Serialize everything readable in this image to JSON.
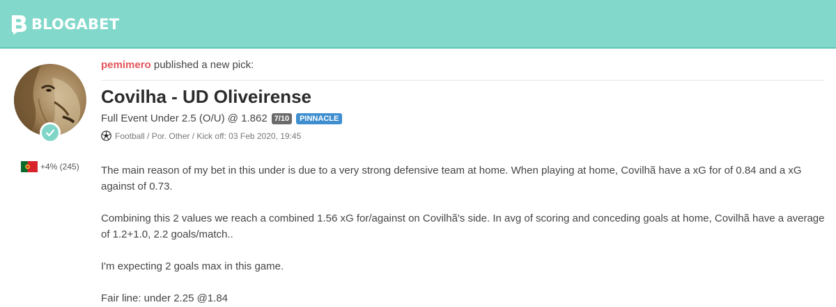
{
  "brand": {
    "name": "BLOGABET",
    "accent": "#82d9cb"
  },
  "post": {
    "username": "pemimero",
    "action": "published a new pick:",
    "user_stats": "+4% (245)",
    "user_flag": "portugal-flag-icon",
    "match": "Covilha - UD Oliveirense",
    "pick": "Full Event Under 2.5 (O/U) @ 1.862",
    "stake": "7/10",
    "bookmaker": "PINNACLE",
    "meta": "Football / Por. Other / Kick off: 03 Feb 2020, 19:45",
    "paragraphs": [
      "The main reason of my bet in this under is due to a very strong defensive team at home. When playing at home, Covilhã have a xG for of 0.84 and a xG against of 0.73.",
      "Combining this 2 values we reach a combined 1.56 xG for/against on Covilhã's side. In avg of scoring and conceding goals at home, Covilhã have a average of 1.2+1.0, 2.2 goals/match..",
      "I'm expecting 2 goals max in this game.",
      "Fair line: under 2.25 @1.84"
    ]
  },
  "colors": {
    "username": "#e1545a",
    "stake_badge": "#6b6b6b",
    "bookmaker_badge": "#3e8ed0",
    "verified_badge": "#7fd6c8"
  }
}
